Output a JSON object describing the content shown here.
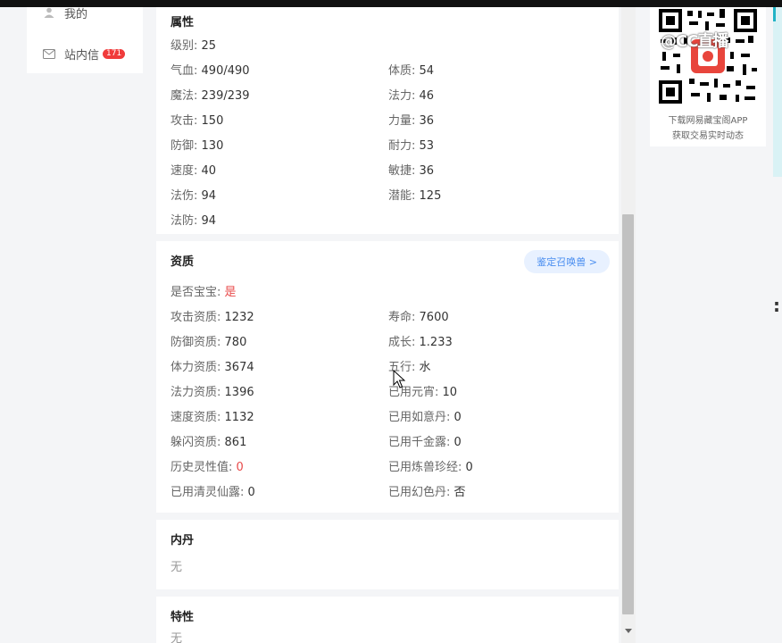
{
  "nav": {
    "items": [
      {
        "label": "我的",
        "icon": "user-icon"
      },
      {
        "label": "站内信",
        "icon": "mail-icon",
        "badge": "171"
      }
    ]
  },
  "attributes": {
    "title": "属性",
    "rows": [
      {
        "key": "级别:",
        "value": "25"
      },
      {
        "key": "气血:",
        "value": "490/490"
      },
      {
        "key": "体质:",
        "value": "54"
      },
      {
        "key": "魔法:",
        "value": "239/239"
      },
      {
        "key": "法力:",
        "value": "46"
      },
      {
        "key": "攻击:",
        "value": "150"
      },
      {
        "key": "力量:",
        "value": "36"
      },
      {
        "key": "防御:",
        "value": "130"
      },
      {
        "key": "耐力:",
        "value": "53"
      },
      {
        "key": "速度:",
        "value": "40"
      },
      {
        "key": "敏捷:",
        "value": "36"
      },
      {
        "key": "法伤:",
        "value": "94"
      },
      {
        "key": "潜能:",
        "value": "125"
      },
      {
        "key": "法防:",
        "value": "94"
      }
    ]
  },
  "aptitude": {
    "title": "资质",
    "appraise_label": "鉴定召唤兽 >",
    "rows": [
      {
        "key": "是否宝宝:",
        "value": "是"
      },
      {
        "key": "攻击资质:",
        "value": "1232"
      },
      {
        "key": "寿命:",
        "value": "7600"
      },
      {
        "key": "防御资质:",
        "value": "780"
      },
      {
        "key": "成长:",
        "value": "1.233"
      },
      {
        "key": "体力资质:",
        "value": "3674"
      },
      {
        "key": "五行:",
        "value": "水"
      },
      {
        "key": "法力资质:",
        "value": "1396"
      },
      {
        "key": "已用元宵:",
        "value": "10"
      },
      {
        "key": "速度资质:",
        "value": "1132"
      },
      {
        "key": "已用如意丹:",
        "value": "0"
      },
      {
        "key": "躲闪资质:",
        "value": "861"
      },
      {
        "key": "已用千金露:",
        "value": "0"
      },
      {
        "key": "历史灵性值:",
        "value": "0"
      },
      {
        "key": "已用炼兽珍经:",
        "value": "0"
      },
      {
        "key": "已用清灵仙露:",
        "value": "0"
      },
      {
        "key": "已用幻色丹:",
        "value": "否"
      }
    ]
  },
  "neidan": {
    "title": "内丹",
    "value": "无"
  },
  "traits": {
    "title": "特性",
    "value": "无"
  },
  "sidebar": {
    "qr_line1": "下载网易藏宝阁APP",
    "qr_line2": "获取交易实时动态",
    "watermark": "@CC直播"
  },
  "colors": {
    "accent": "#4a8ef0",
    "highlight": "#e84a4a",
    "badge": "#f03b3b"
  }
}
